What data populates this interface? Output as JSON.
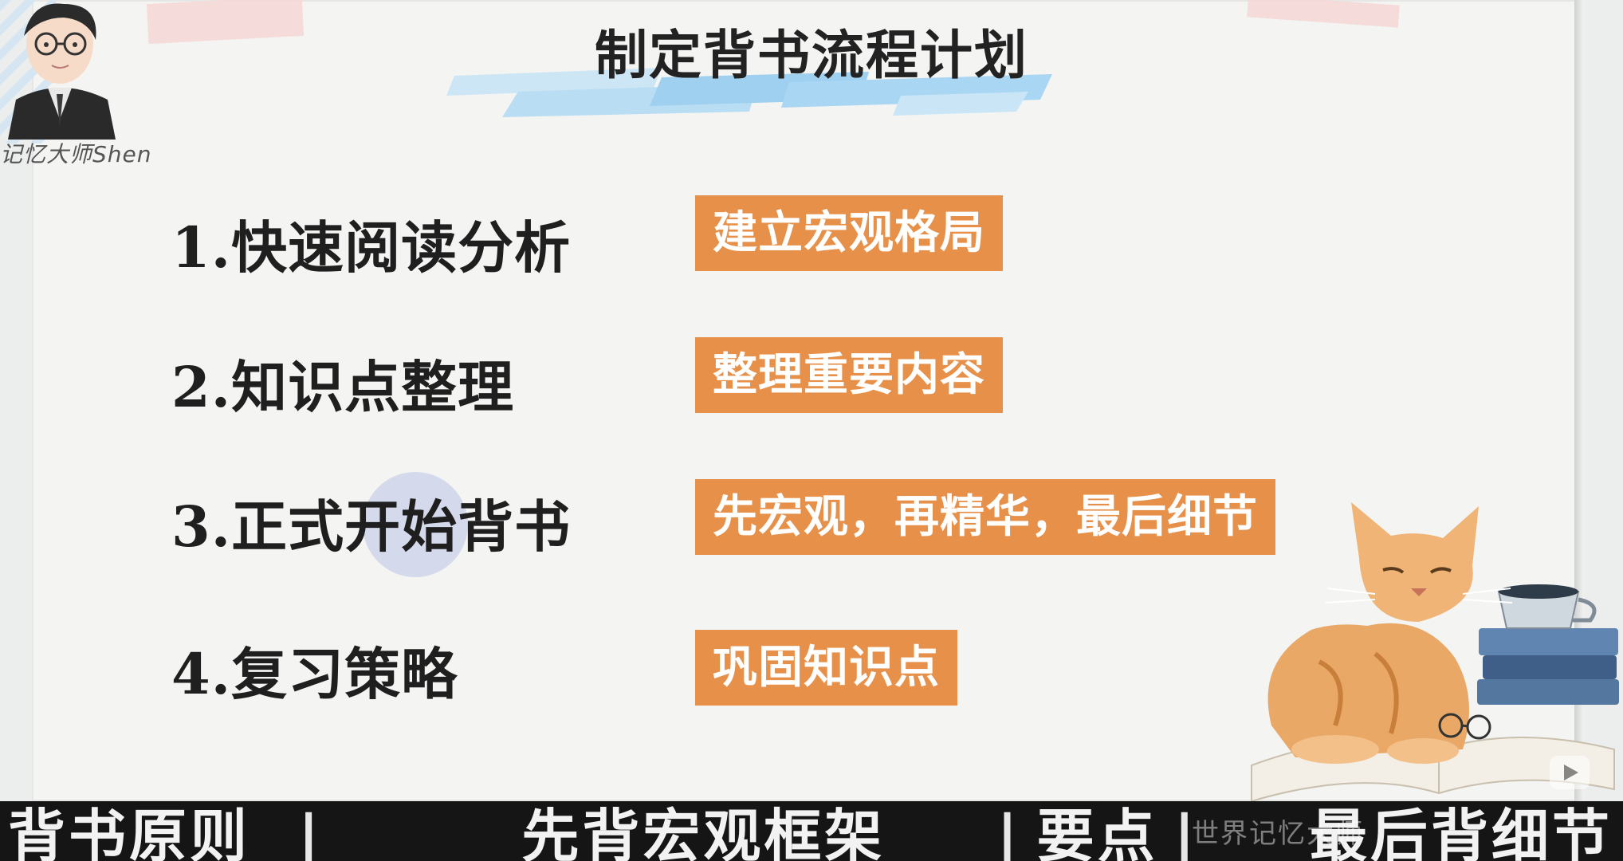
{
  "slide": {
    "title": "制定背书流程计划",
    "author_signature": "记忆大师Shen",
    "steps": [
      {
        "label": "1.快速阅读分析",
        "tag": "建立宏观格局"
      },
      {
        "label": "2.知识点整理",
        "tag": "整理重要内容"
      },
      {
        "label": "3.正式开始背书",
        "tag": "先宏观，再精华，最后细节"
      },
      {
        "label": "4.复习策略",
        "tag": "巩固知识点"
      }
    ]
  },
  "subtitle_bar": {
    "segments": [
      "背书原则",
      "先背宏观框架",
      "要点",
      "最后背细节"
    ],
    "separator": "|"
  },
  "watermark": "世界记忆大师",
  "colors": {
    "tag_background": "#e7904a",
    "tag_text": "#ffffff",
    "title_text": "#222222",
    "subtitle_bar_background": "#151515"
  },
  "icons": {
    "avatar": "cartoon-presenter-avatar",
    "illustration": "cat-with-books-illustration",
    "player_logo": "play-logo-icon"
  }
}
